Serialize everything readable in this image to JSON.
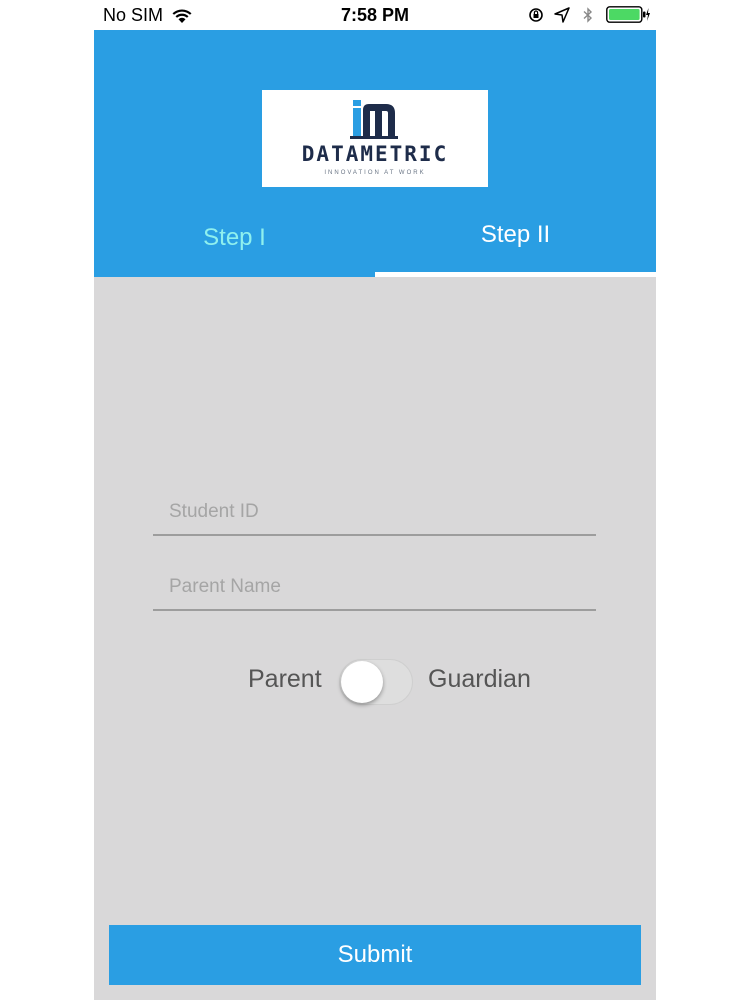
{
  "status_bar": {
    "carrier": "No SIM",
    "time": "7:58 PM",
    "icons": [
      "wifi-icon",
      "orientation-lock-icon",
      "location-icon",
      "bluetooth-icon",
      "battery-icon",
      "charging-icon"
    ]
  },
  "logo": {
    "brand": "DATAMETRIC",
    "tagline": "INNOVATION AT WORK",
    "icon": "datametric-logo-icon"
  },
  "tabs": [
    {
      "label": "Step I",
      "active": false
    },
    {
      "label": "Step II",
      "active": true
    }
  ],
  "form": {
    "student_id": {
      "value": "",
      "placeholder": "Student ID"
    },
    "parent_name": {
      "value": "",
      "placeholder": "Parent Name"
    },
    "role": {
      "left_label": "Parent",
      "right_label": "Guardian",
      "toggle_on": false
    }
  },
  "submit": {
    "label": "Submit"
  },
  "colors": {
    "header_blue": "#2a9ee3",
    "active_tab_text": "#ffffff",
    "inactive_tab_text": "#8ff0ee",
    "background_gray": "#d9d8d9",
    "logo_navy": "#1e2c4a"
  }
}
